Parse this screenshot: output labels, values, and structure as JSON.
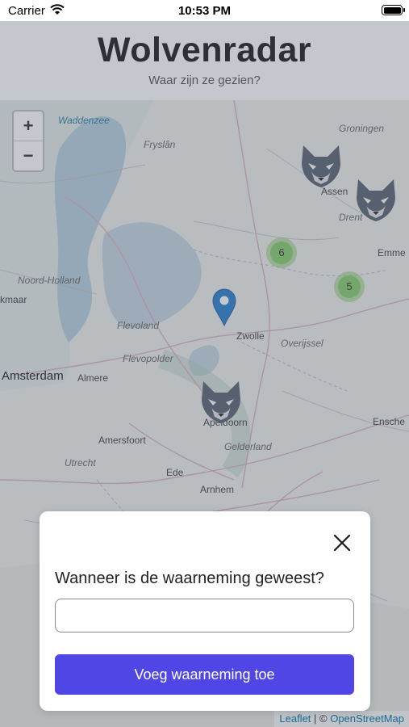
{
  "status_bar": {
    "carrier": "Carrier",
    "time": "10:53 PM"
  },
  "header": {
    "title": "Wolvenradar",
    "subtitle": "Waar zijn ze gezien?"
  },
  "map": {
    "zoom_in": "+",
    "zoom_out": "−",
    "labels": {
      "waddenzee": "Waddenzee",
      "fryslan": "Fryslân",
      "groningen": "Groningen",
      "assen": "Assen",
      "drenthe": "Drent",
      "emmen": "Emme",
      "noord_holland": "Noord-Holland",
      "alkmaar": "kmaar",
      "flevoland": "Flevoland",
      "flevopolder": "Flevopolder",
      "zwolle": "Zwolle",
      "overijssel": "Overijssel",
      "amsterdam": "Amsterdam",
      "almere": "Almere",
      "apeldoorn": "Apeldoorn",
      "enschede": "Ensche",
      "amersfoort": "Amersfoort",
      "gelderland": "Gelderland",
      "utrecht": "Utrecht",
      "ede": "Ede",
      "arnhem": "Arnhem"
    },
    "clusters": [
      {
        "count": "6"
      },
      {
        "count": "5"
      }
    ],
    "markers": [
      "wolf-icon",
      "wolf-icon",
      "wolf-icon",
      "location-pin-icon"
    ],
    "attribution": {
      "leaflet": "Leaflet",
      "separator": " | © ",
      "osm": "OpenStreetMap"
    }
  },
  "modal": {
    "question": "Wanneer is de waarneming geweest?",
    "date_value": "",
    "submit_label": "Voeg waarneming toe"
  },
  "colors": {
    "accent": "#4f46e5",
    "cluster": "#8cd26e",
    "pin": "#2a81cb"
  }
}
